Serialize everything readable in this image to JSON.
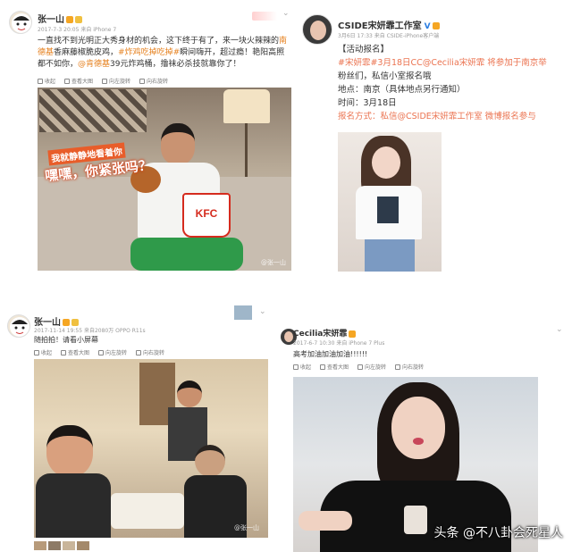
{
  "post1": {
    "user": "张一山",
    "meta": "2017-7-3 20:05 来自 iPhone 7",
    "text_part1": "一直找不到光明正大秀身材的机会，这下终于有了，来一块火辣辣的",
    "text_hl1": "南德基",
    "text_part2": "香麻藤椒脆皮鸡，",
    "text_hl2": "#炸鸡吃掉吃掉#",
    "text_part3": "瞬间嗨开，超过瘾！艳阳高照都不如你，",
    "text_hl3": "@肯德基",
    "text_part4": "39元炸鸡桶，撸袜必杀技就靠你了！",
    "tools": [
      "收起",
      "查看大图",
      "向左旋转",
      "向右旋转"
    ],
    "sticker_top": "我就静静地看着你",
    "sticker_main": "嘿嘿，你紧张吗？",
    "bucket": "KFC",
    "watermark": "@张一山"
  },
  "post2": {
    "user": "CSIDE宋妍霏工作室",
    "meta": "3月6日 17:33 来自 CSIDE-iPhone客户端",
    "lines": [
      "【活动报名】",
      "#宋妍霏#3月18日CC@Cecilia宋妍霏 将参加于南京举",
      "粉丝们，私信小室报名哦",
      "地点：南京（具体地点另行通知）",
      "时间：3月18日",
      "报名方式：私信@CSIDE宋妍霏工作室 微博报名参与"
    ]
  },
  "post3": {
    "user": "张一山",
    "meta": "2017-11-14 19:55 来自2080万 OPPO R11s",
    "text": "随拍拍！请看小屏幕",
    "tools": [
      "收起",
      "查看大图",
      "向左旋转",
      "向右旋转"
    ],
    "watermark": "@张一山"
  },
  "post4": {
    "user": "Cecilia宋妍霏",
    "meta": "2017-6-7 10:30 来自 iPhone 7 Plus",
    "text": "高考加油加油加油!!!!!!",
    "tools": [
      "收起",
      "查看大图",
      "向左旋转",
      "向右旋转"
    ]
  },
  "footer_watermark": "头条 @不八卦会死星人",
  "colors": {
    "accent": "#eb7350",
    "highlight": "#e6811f",
    "badge": "#f5a623"
  }
}
